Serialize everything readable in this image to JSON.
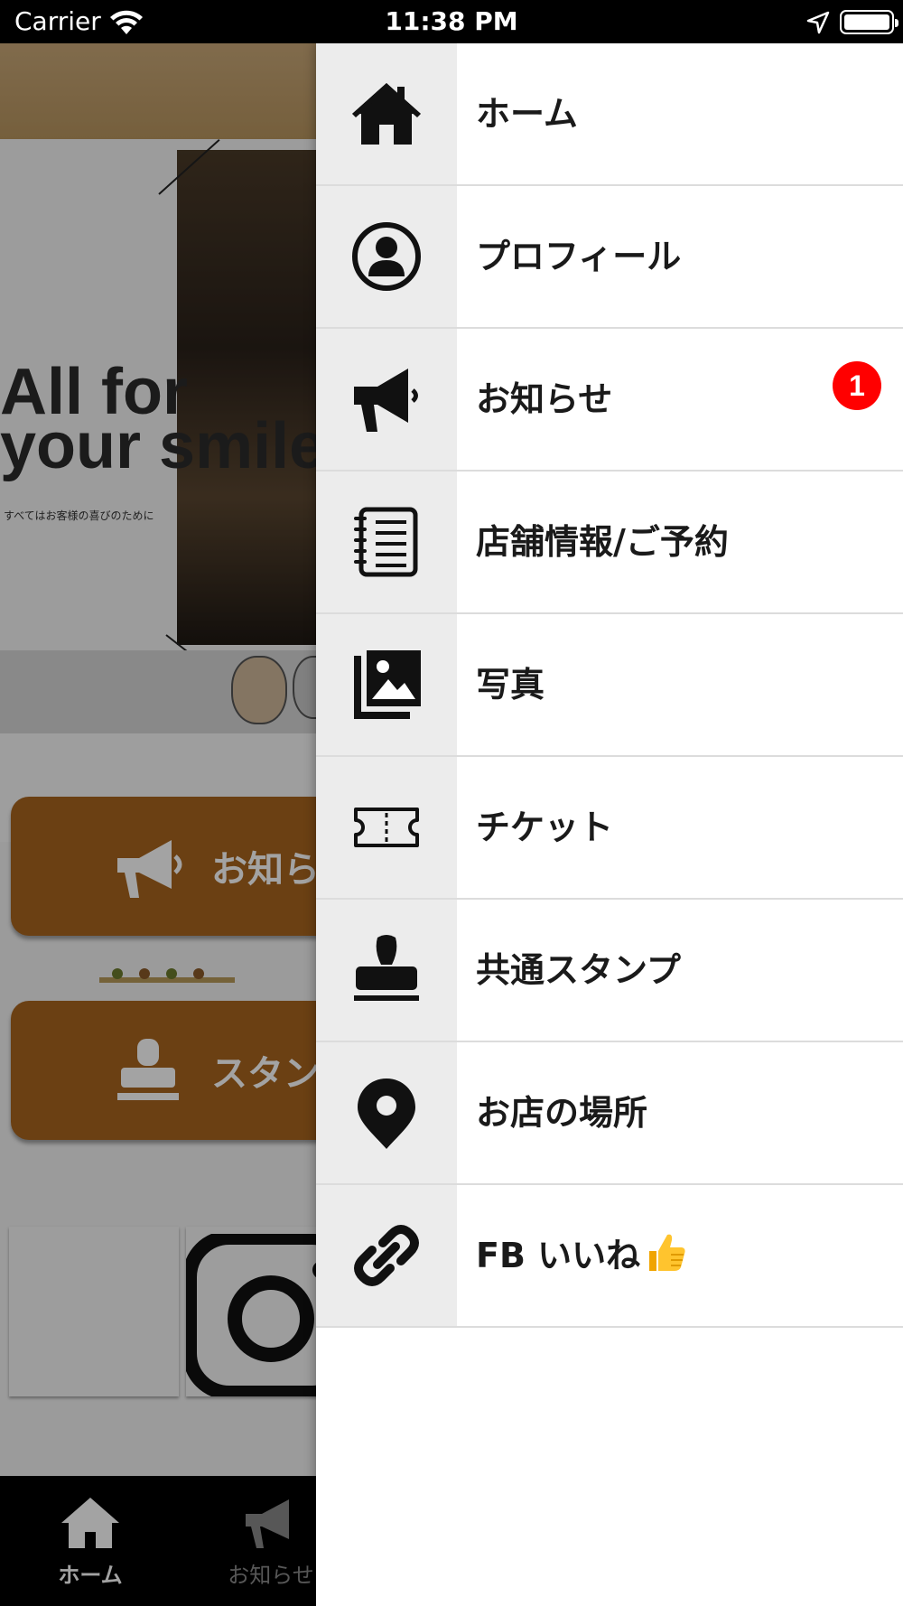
{
  "status_bar": {
    "carrier": "Carrier",
    "time": "11:38 PM"
  },
  "background": {
    "slogan_line1": "All for",
    "slogan_line2": "your smile",
    "slogan_sub": "すべてはお客様の喜びのために",
    "button_news_label": "お知らせ",
    "button_stamp_label": "スタンプ",
    "tab_home_label": "ホーム",
    "tab_news_label": "お知らせ"
  },
  "menu": {
    "items": [
      {
        "label": "ホーム",
        "icon": "home-icon"
      },
      {
        "label": "プロフィール",
        "icon": "profile-icon"
      },
      {
        "label": "お知らせ",
        "icon": "megaphone-icon",
        "badge": "1"
      },
      {
        "label": "店舗情報/ご予約",
        "icon": "notebook-icon"
      },
      {
        "label": "写真",
        "icon": "photo-gallery-icon"
      },
      {
        "label": "チケット",
        "icon": "ticket-icon"
      },
      {
        "label": "共通スタンプ",
        "icon": "stamp-icon"
      },
      {
        "label": "お店の場所",
        "icon": "map-pin-icon"
      },
      {
        "label": "FB いいね",
        "icon": "link-icon",
        "emoji": "thumbs-up"
      }
    ]
  },
  "colors": {
    "accent_brown": "#a8651f",
    "badge_red": "#ff0000",
    "icon_cell_bg": "#ececec"
  }
}
